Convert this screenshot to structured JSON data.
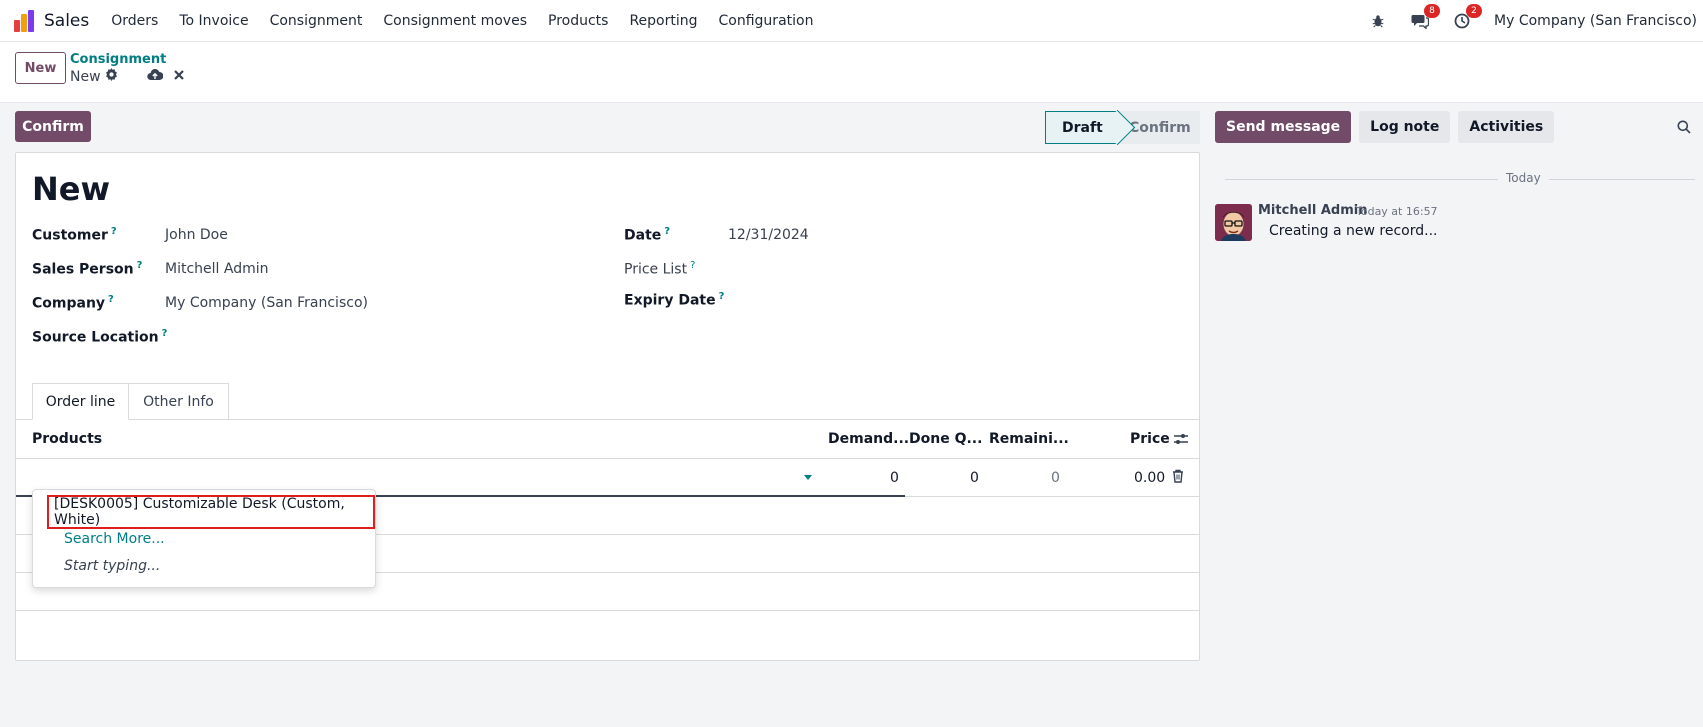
{
  "navbar": {
    "app_name": "Sales",
    "menu": [
      "Orders",
      "To Invoice",
      "Consignment",
      "Consignment moves",
      "Products",
      "Reporting",
      "Configuration"
    ],
    "messages_count": "8",
    "activities_count": "2",
    "company": "My Company (San Francisco)"
  },
  "control": {
    "new_label": "New",
    "breadcrumb": "Consignment",
    "record_name": "New"
  },
  "statusbar": {
    "confirm_label": "Confirm",
    "stages": [
      "Draft",
      "Confirm"
    ]
  },
  "form": {
    "title": "New",
    "left_fields": [
      {
        "label": "Customer",
        "value": "John Doe"
      },
      {
        "label": "Sales Person",
        "value": "Mitchell Admin"
      },
      {
        "label": "Company",
        "value": "My Company (San Francisco)"
      },
      {
        "label": "Source Location",
        "value": ""
      }
    ],
    "right_fields": [
      {
        "label": "Date",
        "value": "12/31/2024"
      },
      {
        "label": "Price List",
        "value": ""
      },
      {
        "label": "Expiry Date",
        "value": ""
      }
    ],
    "help_mark": "?",
    "tabs": [
      "Order line",
      "Other Info"
    ],
    "columns": [
      "Products",
      "Demand...",
      "Done Q...",
      "Remaini...",
      "Price"
    ],
    "edit_row": {
      "demand": "0",
      "done": "0",
      "remaining": "0",
      "price": "0.00"
    }
  },
  "dropdown": {
    "item": "[DESK0005] Customizable Desk (Custom, White)",
    "search_more": "Search More...",
    "start_typing": "Start typing..."
  },
  "chatter": {
    "send_message": "Send message",
    "log_note": "Log note",
    "activities": "Activities",
    "today": "Today",
    "author": "Mitchell Admin",
    "time": "Today at 16:57",
    "body": "Creating a new record..."
  },
  "colors": {
    "brand": "#714b67",
    "accent": "#017e84",
    "badge": "#dc2626",
    "highlight": "#e11d1d"
  }
}
